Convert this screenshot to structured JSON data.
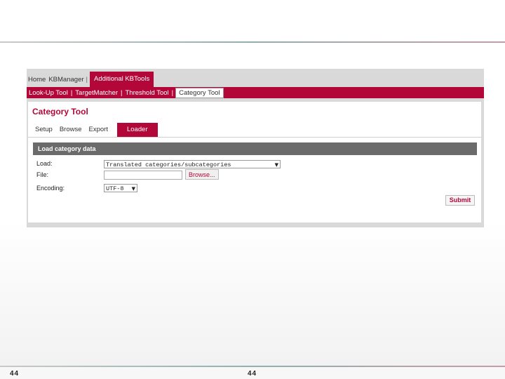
{
  "topnav": {
    "items": [
      "Home",
      "KBManager",
      "Additional KBTools"
    ]
  },
  "subnav": {
    "items": [
      "Look-Up Tool",
      "TargetMatcher",
      "Threshold Tool",
      "Category Tool"
    ]
  },
  "panel": {
    "title": "Category Tool",
    "tabs": [
      "Setup",
      "Browse",
      "Export",
      "Loader"
    ]
  },
  "form": {
    "section_title": "Load category data",
    "load_label": "Load:",
    "load_value": "Translated categories/subcategories",
    "file_label": "File:",
    "file_value": "",
    "browse_label": "Browse...",
    "encoding_label": "Encoding:",
    "encoding_value": "UTF-8",
    "submit_label": "Submit"
  },
  "footer": {
    "page_left": "44",
    "page_center": "44"
  },
  "colors": {
    "accent": "#b3073a",
    "section_bar": "#6b6b6b"
  },
  "icons": {
    "dropdown": "chevron-down-icon"
  }
}
